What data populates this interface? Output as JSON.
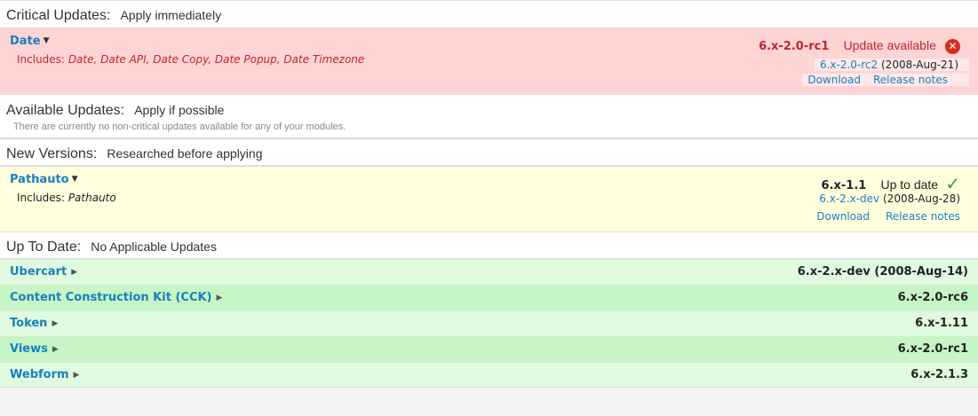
{
  "sections": {
    "critical": {
      "title": "Critical Updates:",
      "subtitle": "Apply immediately"
    },
    "available": {
      "title": "Available Updates:",
      "subtitle": "Apply if possible",
      "note": "There are currently no non-critical updates available for any of your modules."
    },
    "newversions": {
      "title": "New Versions:",
      "subtitle": "Researched before applying"
    },
    "uptodate": {
      "title": "Up To Date:",
      "subtitle": "No Applicable Updates"
    }
  },
  "critical_project": {
    "name": "Date",
    "includes_label": "Includes:",
    "includes": "Date, Date API, Date Copy, Date Popup, Date Timezone",
    "version": "6.x-2.0-rc1",
    "status": "Update available",
    "status_icon": "error-icon",
    "recommended_version": "6.x-2.0-rc2",
    "recommended_date": "(2008-Aug-21)",
    "download": "Download",
    "release_notes": "Release notes"
  },
  "new_project": {
    "name": "Pathauto",
    "includes_label": "Includes:",
    "includes": "Pathauto",
    "version": "6.x-1.1",
    "status": "Up to date",
    "status_icon": "check-icon",
    "recommended_version": "6.x-2.x-dev",
    "recommended_date": "(2008-Aug-28)",
    "download": "Download",
    "release_notes": "Release notes"
  },
  "uptodate_projects": [
    {
      "name": "Ubercart",
      "version": "6.x-2.x-dev (2008-Aug-14)"
    },
    {
      "name": "Content Construction Kit (CCK)",
      "version": "6.x-2.0-rc6"
    },
    {
      "name": "Token",
      "version": "6.x-1.11"
    },
    {
      "name": "Views",
      "version": "6.x-2.0-rc1"
    },
    {
      "name": "Webform",
      "version": "6.x-2.1.3"
    }
  ],
  "colors": {
    "critical_bg": "#ffd4d4",
    "new_bg": "#ffffdd",
    "ok_bg_a": "#dffadf",
    "ok_bg_b": "#c6f5c6",
    "link": "#1a7fc0",
    "error": "#c0262c"
  }
}
